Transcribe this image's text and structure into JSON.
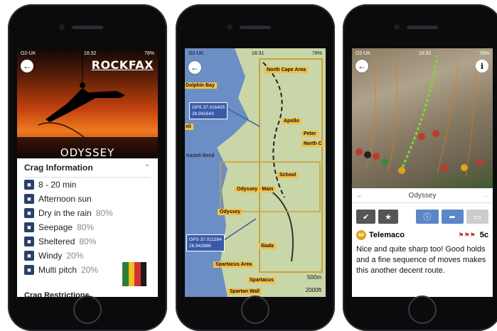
{
  "colors": {
    "rockfax_blue": "#5b86c8",
    "route_yellow": "#e0a21a",
    "map_label": "#f2c04a",
    "gps_box": "#3a5aa8"
  },
  "phone1": {
    "status": {
      "carrier": "O2-UK",
      "time": "16:32",
      "battery": "78%"
    },
    "back_icon": "arrow-left-icon",
    "brand": "ROCKFAX",
    "route_name": "ODYSSEY",
    "section_title": "Crag Information",
    "items": [
      {
        "icon": "walk-icon",
        "text": "8 - 20 min",
        "pct": ""
      },
      {
        "icon": "sun-icon",
        "text": "Afternoon sun",
        "pct": ""
      },
      {
        "icon": "rain-icon",
        "text": "Dry in the rain",
        "pct": "80%"
      },
      {
        "icon": "seepage-icon",
        "text": "Seepage",
        "pct": "80%"
      },
      {
        "icon": "shelter-icon",
        "text": "Sheltered",
        "pct": "80%"
      },
      {
        "icon": "wind-icon",
        "text": "Windy",
        "pct": "20%"
      },
      {
        "icon": "multipitch-icon",
        "text": "Multi pitch",
        "pct": "20%"
      }
    ],
    "next_section": "Crag Restrictions"
  },
  "phone2": {
    "status": {
      "carrier": "O2-UK",
      "time": "16:31",
      "battery": "78%"
    },
    "labels": [
      {
        "text": "North Cape Area"
      },
      {
        "text": "Dolphin Bay"
      },
      {
        "text": "Apollo"
      },
      {
        "text": "Peter"
      },
      {
        "text": "North C"
      },
      {
        "text": "eli"
      },
      {
        "text": "Kasteli Bend"
      },
      {
        "text": "School"
      },
      {
        "text": "Odyssey - Main"
      },
      {
        "text": "Odyssey"
      },
      {
        "text": "Iliada"
      },
      {
        "text": "Spartacus Area"
      },
      {
        "text": "Spartacus"
      },
      {
        "text": "Spartan Wall"
      }
    ],
    "gps1": {
      "line1": "GPS 37.016405",
      "line2": "26.941643"
    },
    "gps2": {
      "line1": "GPS 37.011284",
      "line2": "26.942886"
    },
    "scale_m": "500m",
    "scale_ft": "2000ft"
  },
  "phone3": {
    "status": {
      "carrier": "O2-UK",
      "time": "16:32",
      "battery": "78%"
    },
    "nav_title": "Odyssey",
    "route": {
      "grade_number": "60",
      "name": "Telemaco",
      "grade": "5c"
    },
    "description": "Nice and quite sharp too! Good holds and a fine sequence of moves makes this another decent route."
  }
}
